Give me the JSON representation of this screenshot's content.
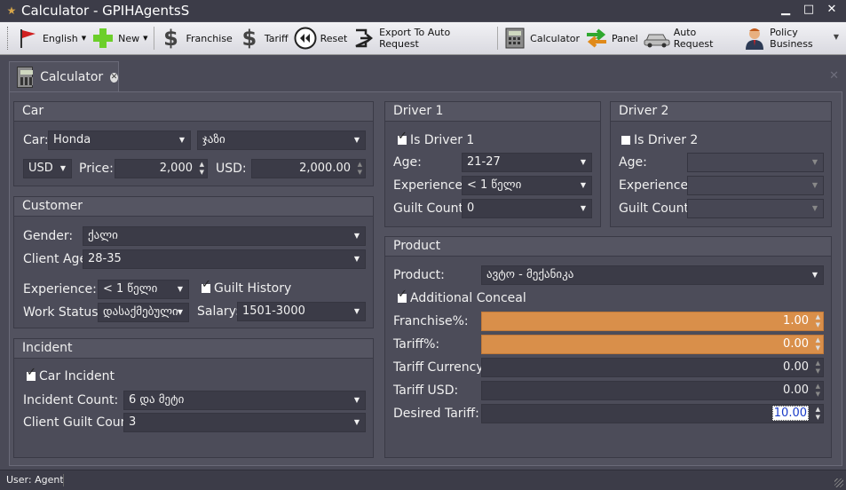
{
  "window": {
    "title": "Calculator - GPIHAgentsS"
  },
  "toolbar": {
    "english": "English",
    "new": "New",
    "franchise": "Franchise",
    "tariff": "Tariff",
    "reset": "Reset",
    "export": "Export To Auto Request",
    "calculator": "Calculator",
    "panel": "Panel",
    "auto_request": "Auto Request",
    "policy_business": "Policy Business"
  },
  "tab": {
    "label": "Calculator"
  },
  "car": {
    "title": "Car",
    "car_label": "Car:",
    "make": "Honda",
    "model": "ჯაზი",
    "currency": "USD",
    "price_label": "Price:",
    "price": "2,000",
    "usd_label": "USD:",
    "usd_value": "2,000.00"
  },
  "customer": {
    "title": "Customer",
    "gender_label": "Gender:",
    "gender": "ქალი",
    "age_label": "Client Age:",
    "age": "28-35",
    "experience_label": "Experience:",
    "experience": "< 1 წელი",
    "guilt_history": "Guilt History",
    "work_status_label": "Work Status:",
    "work_status": "დასაქმებული",
    "salary_label": "Salary:",
    "salary": "1501-3000"
  },
  "incident": {
    "title": "Incident",
    "car_incident": "Car Incident",
    "count_label": "Incident Count:",
    "count": "6 და მეტი",
    "guilt_label": "Client Guilt Count:",
    "guilt": "3"
  },
  "driver1": {
    "title": "Driver 1",
    "is_driver": "Is Driver 1",
    "age_label": "Age:",
    "age": "21-27",
    "experience_label": "Experience:",
    "experience": "< 1 წელი",
    "guilt_label": "Guilt Count:",
    "guilt": "0"
  },
  "driver2": {
    "title": "Driver 2",
    "is_driver": "Is Driver 2",
    "age_label": "Age:",
    "experience_label": "Experience:",
    "guilt_label": "Guilt Count:"
  },
  "product": {
    "title": "Product",
    "product_label": "Product:",
    "product": "ავტო - მექანიკა",
    "additional_conceal": "Additional Conceal",
    "franchise_label": "Franchise%:",
    "franchise": "1.00",
    "tariff_label": "Tariff%:",
    "tariff": "0.00",
    "currency_label": "Tariff Currency:",
    "currency": "0.00",
    "usd_label": "Tariff USD:",
    "usd": "0.00",
    "desired_label": "Desired Tariff:",
    "desired": "10.00"
  },
  "status": {
    "user": "User: Agent"
  },
  "colors": {
    "accent_orange": "#d98f4a",
    "panel_bg": "#4c4c59"
  }
}
